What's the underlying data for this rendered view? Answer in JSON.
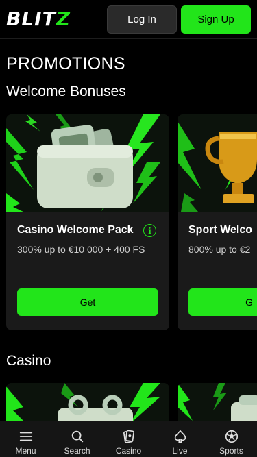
{
  "header": {
    "logo_main": "BLIT",
    "logo_accent": "Z",
    "login_label": "Log In",
    "signup_label": "Sign Up"
  },
  "page_title": "PROMOTIONS",
  "sections": [
    {
      "title": "Welcome Bonuses",
      "cards": [
        {
          "title": "Casino Welcome Pack",
          "subtitle": "300% up to €10 000 + 400 FS",
          "button": "Get",
          "image": "wallet-icon"
        },
        {
          "title": "Sport Welco",
          "subtitle": "800% up to €2",
          "button": "G",
          "image": "trophy-icon"
        }
      ]
    },
    {
      "title": "Casino"
    }
  ],
  "info_glyph": "i",
  "nav": [
    {
      "label": "Menu",
      "icon": "menu-icon"
    },
    {
      "label": "Search",
      "icon": "search-icon"
    },
    {
      "label": "Casino",
      "icon": "cards-icon"
    },
    {
      "label": "Live",
      "icon": "spade-icon"
    },
    {
      "label": "Sports",
      "icon": "soccer-ball-icon"
    }
  ],
  "colors": {
    "accent": "#22e51a",
    "background": "#000000",
    "card": "#1a1a1a"
  }
}
